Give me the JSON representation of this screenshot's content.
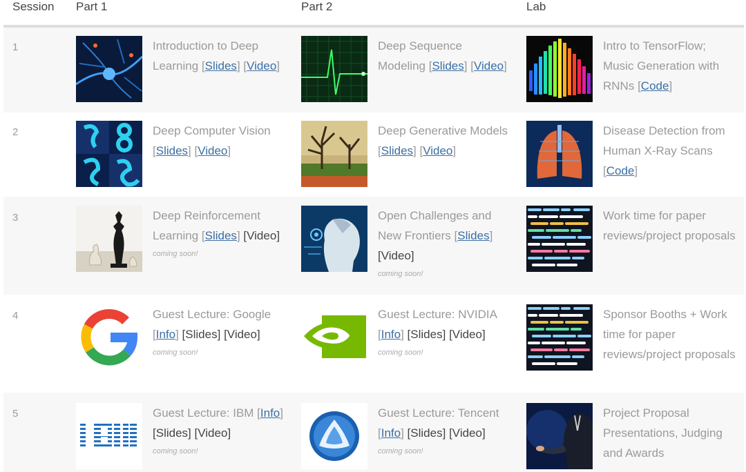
{
  "header": {
    "session": "Session",
    "part1": "Part 1",
    "part2": "Part 2",
    "lab": "Lab"
  },
  "soon_label": "coming soon!",
  "link_labels": {
    "slides": "Slides",
    "video": "Video",
    "code": "Code",
    "info": "Info"
  },
  "rows": [
    {
      "session": "1",
      "part1": {
        "title": "Introduction to Deep Learning"
      },
      "part2": {
        "title": "Deep Sequence Modeling"
      },
      "lab": {
        "title": "Intro to TensorFlow; Music Generation with RNNs"
      }
    },
    {
      "session": "2",
      "part1": {
        "title": "Deep Computer Vision"
      },
      "part2": {
        "title": "Deep Generative Models"
      },
      "lab": {
        "title": "Disease Detection from Human X-Ray Scans"
      }
    },
    {
      "session": "3",
      "part1": {
        "title": "Deep Reinforcement Learning"
      },
      "part2": {
        "title": "Open Challenges and New Frontiers"
      },
      "lab": {
        "title": "Work time for paper reviews/project proposals"
      }
    },
    {
      "session": "4",
      "part1": {
        "title": "Guest Lecture: Google"
      },
      "part2": {
        "title": "Guest Lecture: NVIDIA"
      },
      "lab": {
        "title": "Sponsor Booths + Work time for paper reviews/project proposals"
      }
    },
    {
      "session": "5",
      "part1": {
        "title": "Guest Lecture: IBM"
      },
      "part2": {
        "title": "Guest Lecture: Tencent"
      },
      "lab": {
        "title": "Project Proposal Presentations, Judging and Awards"
      }
    }
  ],
  "icons": {
    "r1_p1": "neuron-image",
    "r1_p2": "heartbeat-image",
    "r1_lab": "audio-spectrum-image",
    "r2_p1": "handwritten-digits-image",
    "r2_p2": "painted-landscape-image",
    "r2_lab": "lung-xray-image",
    "r3_p1": "chess-pieces-image",
    "r3_p2": "robot-head-image",
    "r3_lab": "code-screen-image",
    "r4_p1": "google-logo",
    "r4_p2": "nvidia-logo",
    "r4_lab": "code-screen-image",
    "r5_p1": "ibm-logo",
    "r5_p2": "tencent-logo",
    "r5_lab": "presenter-image"
  },
  "colors": {
    "link": "#3a6ea5",
    "row_shade": "#f7f7f7",
    "header_rule": "#dddddd"
  }
}
